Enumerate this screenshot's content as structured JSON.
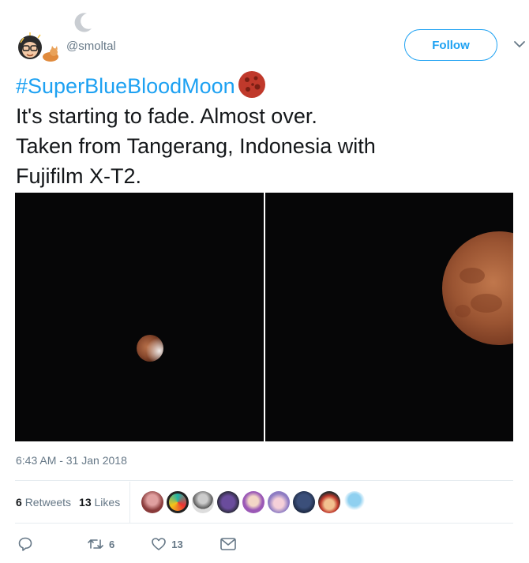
{
  "author": {
    "handle": "@smoltal"
  },
  "follow_label": "Follow",
  "tweet": {
    "hashtag": "#SuperBlueBloodMoon",
    "line1": "It's starting to fade. Almost over.",
    "line2": "Taken from Tangerang, Indonesia with",
    "line3": "Fujifilm X-T2."
  },
  "timestamp": "6:43 AM - 31 Jan 2018",
  "stats": {
    "retweets_count": "6",
    "retweets_label": "Retweets",
    "likes_count": "13",
    "likes_label": "Likes"
  },
  "actions": {
    "retweet_count": "6",
    "like_count": "13"
  },
  "icons": [
    "crescent-moon-icon",
    "reply-icon",
    "retweet-icon",
    "heart-icon",
    "dm-icon",
    "chevron-down-icon"
  ],
  "colors": {
    "accent": "#1da1f2",
    "text": "#14171a",
    "muted": "#657786"
  }
}
